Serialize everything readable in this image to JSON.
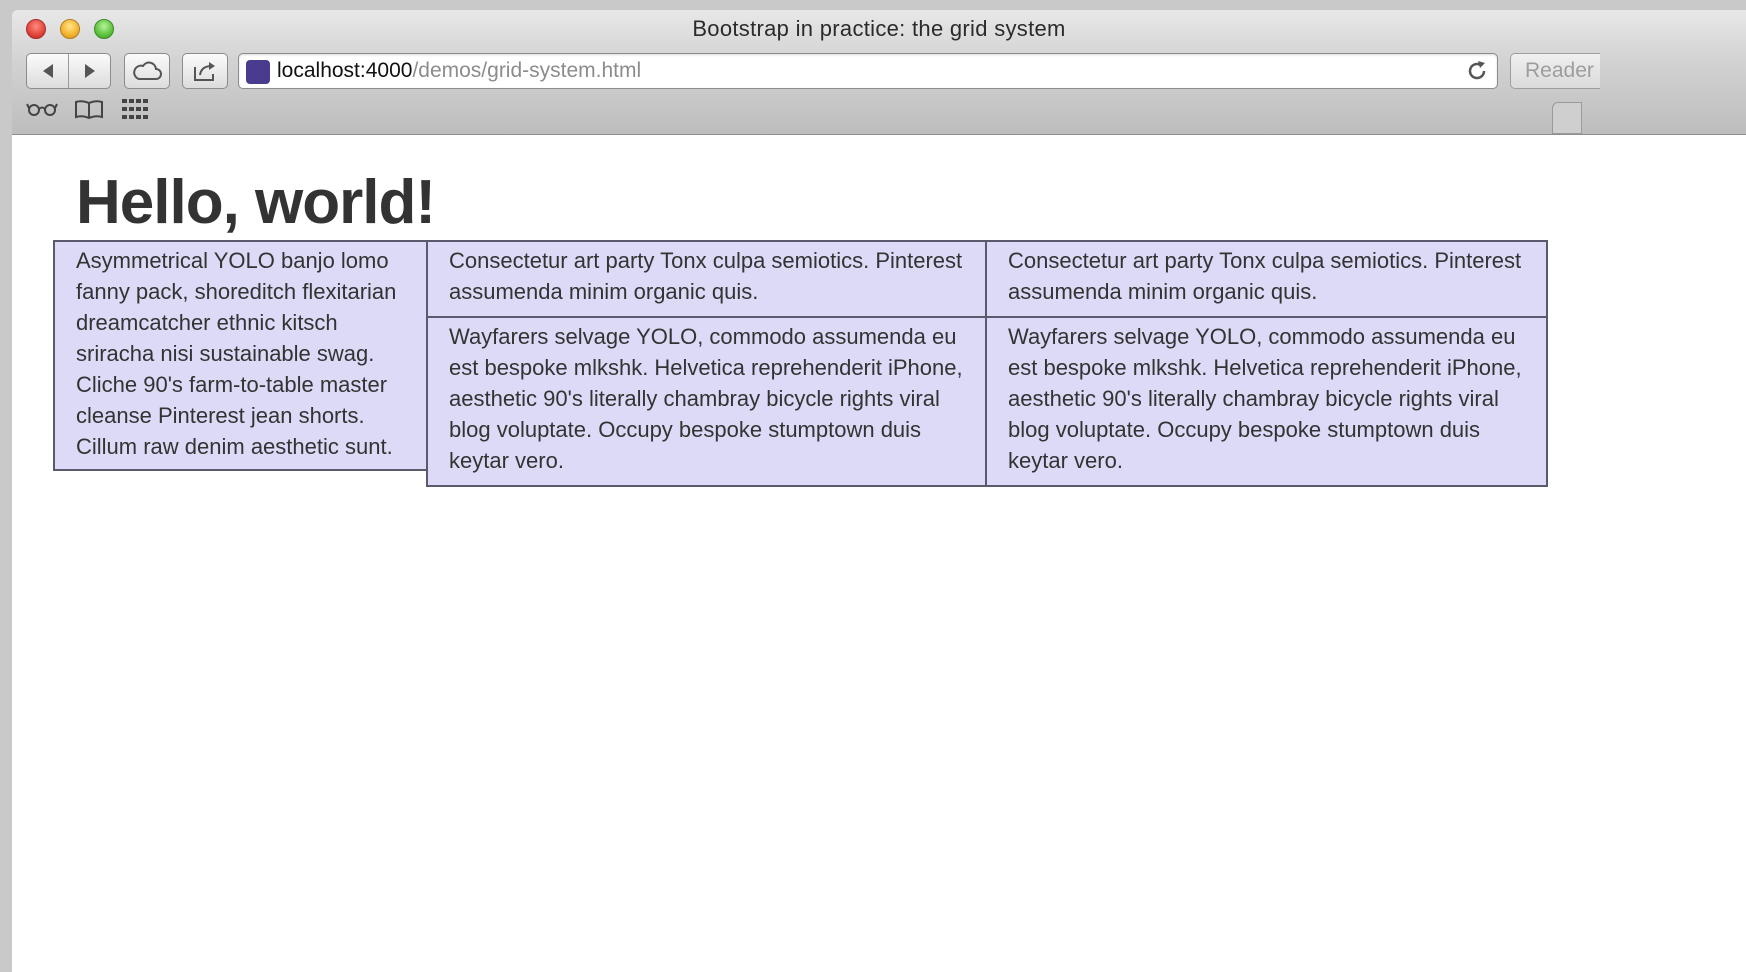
{
  "window": {
    "title": "Bootstrap in practice: the grid system"
  },
  "toolbar": {
    "url_host": "localhost:4000",
    "url_path": "/demos/grid-system.html",
    "reader_label": "Reader"
  },
  "bookmarks_bar": {
    "icons": [
      "reading-list-icon",
      "bookmarks-icon",
      "top-sites-icon"
    ]
  },
  "page": {
    "heading": "Hello, world!",
    "col1": "Asymmetrical YOLO banjo lomo fanny pack, shoreditch flexitarian dreamcatcher ethnic kitsch sriracha nisi sustainable swag. Cliche 90's farm-to-table master cleanse Pinterest jean shorts. Cillum raw denim aesthetic sunt.",
    "col2_top": "Consectetur art party Tonx culpa semiotics. Pinterest assumenda minim organic quis.",
    "col2_bottom": "Wayfarers selvage YOLO, commodo assumenda eu est bespoke mlkshk. Helvetica reprehenderit iPhone, aesthetic 90's literally chambray bicycle rights viral blog voluptate. Occupy bespoke stumptown duis keytar vero.",
    "col3_top": "Consectetur art party Tonx culpa semiotics. Pinterest assumenda minim organic quis.",
    "col3_bottom": "Wayfarers selvage YOLO, commodo assumenda eu est bespoke mlkshk. Helvetica reprehenderit iPhone, aesthetic 90's literally chambray bicycle rights viral blog voluptate. Occupy bespoke stumptown duis keytar vero."
  },
  "colors": {
    "cell_background": "#dcdaf6",
    "cell_border": "#5a5a6e",
    "heading": "#333333"
  }
}
